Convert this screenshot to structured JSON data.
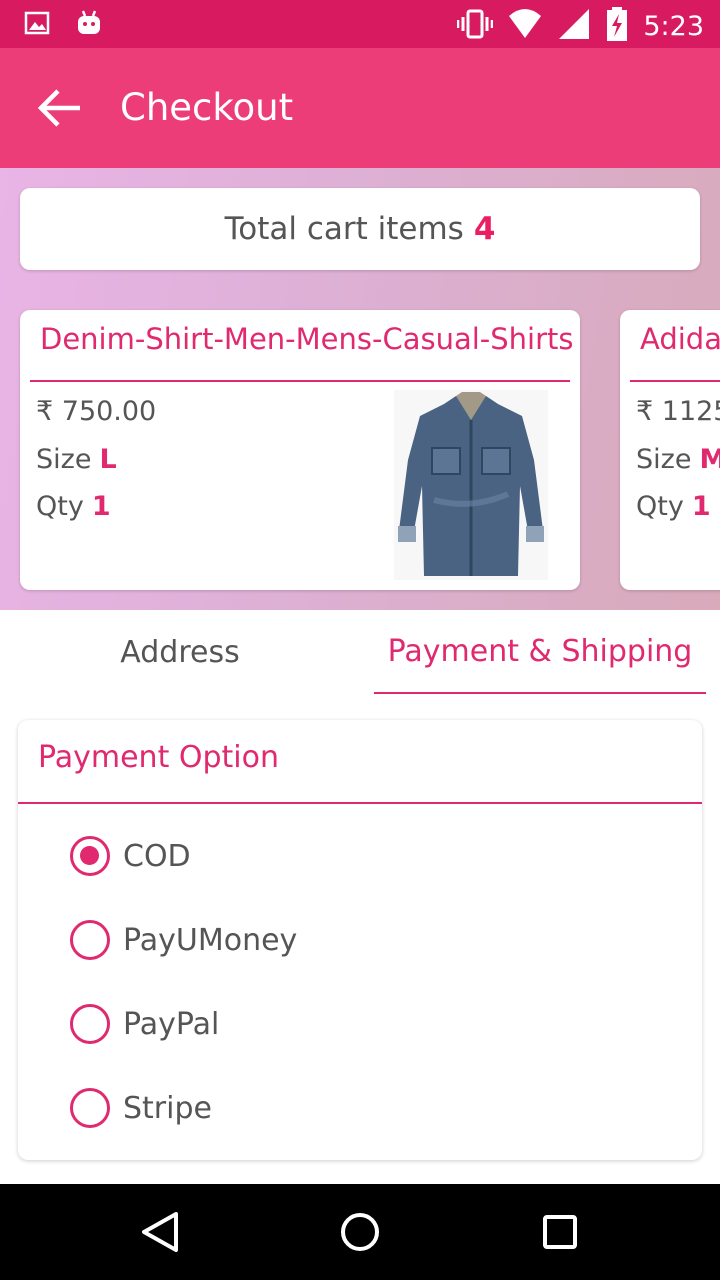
{
  "status_bar": {
    "time": "5:23",
    "left_icons": [
      "image-icon",
      "android-icon"
    ],
    "right_icons": [
      "vibrate-icon",
      "wifi-icon",
      "signal-icon",
      "battery-charging-icon"
    ]
  },
  "app_bar": {
    "title": "Checkout",
    "back_icon": "arrow-back-icon"
  },
  "cart_summary": {
    "label": "Total cart items",
    "count": "4"
  },
  "products": [
    {
      "name": "Denim-Shirt-Men-Mens-Casual-Shirts",
      "price": "₹ 750.00",
      "size_label": "Size",
      "size": "L",
      "qty_label": "Qty",
      "qty": "1"
    },
    {
      "name": "Adida",
      "price": "₹ 1125",
      "size_label": "Size",
      "size": "M",
      "qty_label": "Qty",
      "qty": "1"
    }
  ],
  "tabs": {
    "address": "Address",
    "payment": "Payment & Shipping"
  },
  "payment": {
    "heading": "Payment Option",
    "options": [
      "COD",
      "PayUMoney",
      "PayPal",
      "Stripe"
    ],
    "selected": "COD"
  },
  "nav_bar": {
    "icons": [
      "back-triangle-icon",
      "home-circle-icon",
      "recents-square-icon"
    ]
  },
  "colors": {
    "status_bar": "#d81b60",
    "app_bar": "#ec3d78",
    "accent": "#e0296f",
    "text": "#555555"
  }
}
